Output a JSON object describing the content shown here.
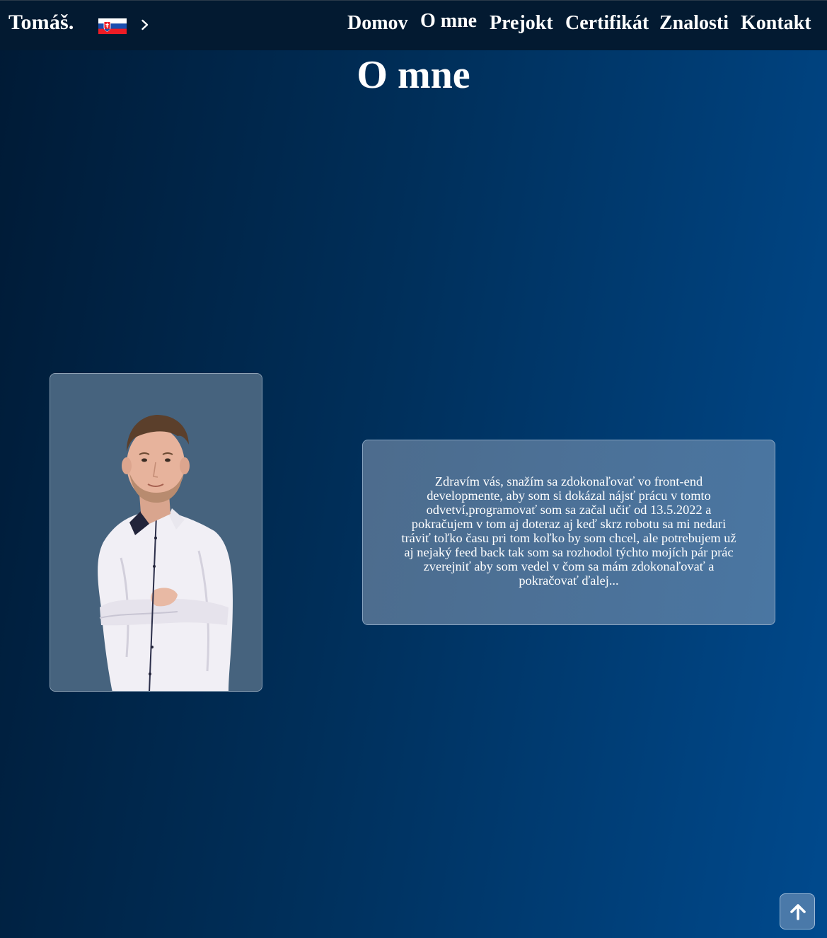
{
  "navbar": {
    "brand": "Tomáš.",
    "language_flag": "slovakia-flag-icon",
    "language_chevron": "chevron-right-icon",
    "links": [
      {
        "label": "Domov"
      },
      {
        "label": "O mne"
      },
      {
        "label": "Prejokt"
      },
      {
        "label": "Certifikát"
      },
      {
        "label": "Znalosti"
      },
      {
        "label": "Kontakt"
      }
    ],
    "active_link": "O mne"
  },
  "main": {
    "title": "O mne",
    "photo": "portrait-photo",
    "about_text": "Zdravím vás, snažím sa zdokonaľovať vo front-end developmente, aby som si dokázal nájsť prácu v tomto odvetví,programovať som sa začal učiť od 13.5.2022 a pokračujem v tom aj doteraz aj keď skrz robotu sa mi nedari tráviť toľko času pri tom koľko by som chcel, ale potrebujem už aj nejaký feed back tak som sa rozhodol týchto mojích pár prác zverejniť aby som vedel v čom sa mám zdokonaľovať a pokračovať ďalej..."
  },
  "scroll_top": {
    "icon": "arrow-up-icon"
  },
  "colors": {
    "navbar_bg": "#031a31",
    "background_start": "#001a35",
    "background_end": "#004a8e",
    "card_bg": "#46637e",
    "text": "#ffffff"
  }
}
